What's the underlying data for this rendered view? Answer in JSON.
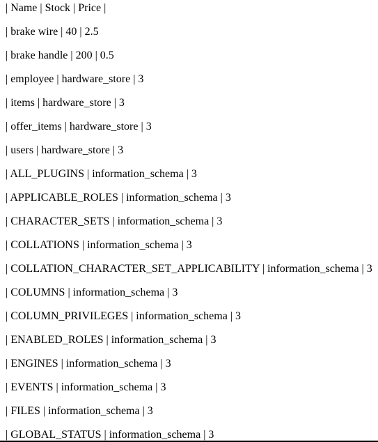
{
  "output": {
    "lines": [
      "| Name | Stock | Price |",
      "| brake wire | 40 | 2.5",
      "| brake handle | 200 | 0.5",
      "| employee | hardware_store | 3",
      "| items | hardware_store | 3",
      "| offer_items | hardware_store | 3",
      "| users | hardware_store | 3",
      "| ALL_PLUGINS | information_schema | 3",
      "| APPLICABLE_ROLES | information_schema | 3",
      "| CHARACTER_SETS | information_schema | 3",
      "| COLLATIONS | information_schema | 3",
      "| COLLATION_CHARACTER_SET_APPLICABILITY | information_schema | 3",
      "| COLUMNS | information_schema | 3",
      "| COLUMN_PRIVILEGES | information_schema | 3",
      "| ENABLED_ROLES | information_schema | 3",
      "| ENGINES | information_schema | 3",
      "| EVENTS | information_schema | 3",
      "| FILES | information_schema | 3",
      "| GLOBAL_STATUS | information_schema | 3"
    ]
  }
}
